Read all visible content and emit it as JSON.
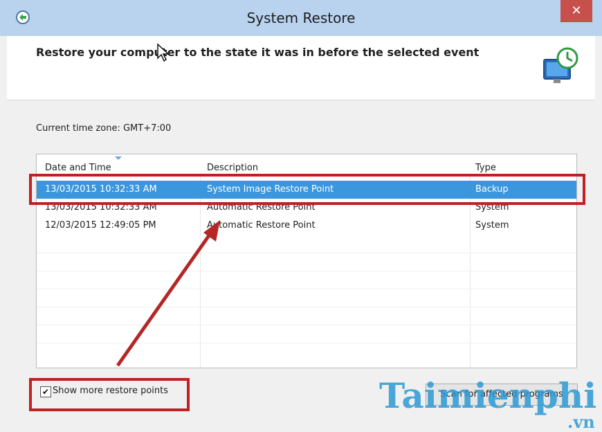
{
  "window": {
    "title": "System Restore",
    "close_glyph": "✕",
    "icon": "system-restore-app-icon"
  },
  "header": {
    "headline": "Restore your computer to the state it was in before the selected event",
    "icon": "restore-point-monitor-icon"
  },
  "timezone": "Current time zone: GMT+7:00",
  "restore_points": {
    "columns": [
      "Date and Time",
      "Description",
      "Type"
    ],
    "rows": [
      {
        "date": "13/03/2015 10:32:33 AM",
        "description": "System Image Restore Point",
        "type": "Backup",
        "selected": true
      },
      {
        "date": "13/03/2015 10:32:33 AM",
        "description": "Automatic Restore Point",
        "type": "System",
        "selected": false
      },
      {
        "date": "12/03/2015 12:49:05 PM",
        "description": "Automatic Restore Point",
        "type": "System",
        "selected": false
      }
    ]
  },
  "show_more": {
    "label": "Show more restore points",
    "checked": true,
    "check_glyph": "✔"
  },
  "scan_button": "Scan for affected programs",
  "watermark": {
    "text": "Taimienphi",
    "sub": ".vn"
  },
  "colors": {
    "selection": "#3a96dd",
    "annotation_red": "#c02020",
    "titlebar": "#b9d2ee"
  }
}
